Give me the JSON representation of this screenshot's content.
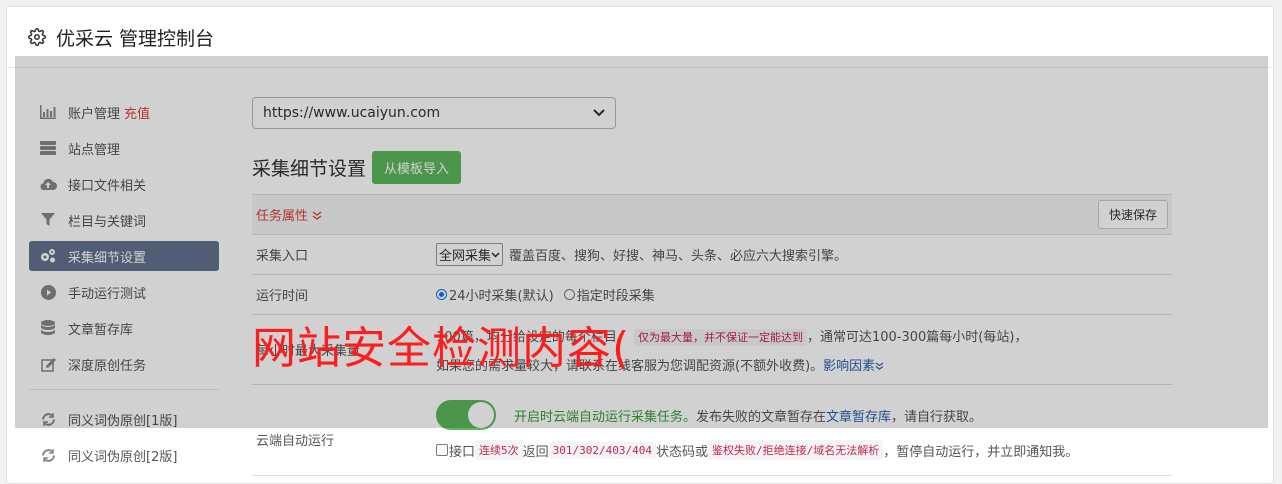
{
  "header": {
    "title": "优采云 管理控制台",
    "icon": "gear-icon"
  },
  "sidebar": {
    "items": [
      {
        "label": "账户管理",
        "badge": "充值",
        "icon": "bar-chart-icon"
      },
      {
        "label": "站点管理",
        "icon": "server-icon"
      },
      {
        "label": "接口文件相关",
        "icon": "cloud-upload-icon"
      },
      {
        "label": "栏目与关键词",
        "icon": "filter-icon"
      },
      {
        "label": "采集细节设置",
        "icon": "gears-icon",
        "active": true
      },
      {
        "label": "手动运行测试",
        "icon": "play-icon"
      },
      {
        "label": "文章暂存库",
        "icon": "database-icon"
      },
      {
        "label": "深度原创任务",
        "icon": "edit-icon"
      },
      {
        "label": "同义词伪原创[1版]",
        "icon": "refresh-icon"
      },
      {
        "label": "同义词伪原创[2版]",
        "icon": "refresh-icon"
      }
    ]
  },
  "main": {
    "site_select": "https://www.ucaiyun.com",
    "section_title": "采集细节设置",
    "import_button": "从模板导入",
    "task_property": "任务属性",
    "quick_save": "快速保存",
    "entry": {
      "label": "采集入口",
      "select": "全网采集",
      "desc": "覆盖百度、搜狗、好搜、神马、头条、必应六大搜索引擎。"
    },
    "runtime": {
      "label": "运行时间",
      "opt1": "24小时采集(默认)",
      "opt2": "指定时段采集"
    },
    "max_label": "每小时最大采集量",
    "max": {
      "prefix": "100",
      "mid": "篇，均分给设定的每个栏目。",
      "code": "仅为最大量，并不保证一定能达到",
      "suffix": "，通常可达100-300篇每小时(每站)，",
      "line2": "如果您的需求量较大，请联系在线客服为您调配资源(不额外收费)。",
      "link": "影响因素"
    },
    "cloud": {
      "label": "云端自动运行",
      "desc_green": "开启时云端自动运行采集任务。",
      "desc": "发布失败的文章暂存在",
      "desc_link": "文章暂存库",
      "desc_end": "，请自行获取。",
      "check_label": "接口",
      "code1": "连续5次",
      "t1": "返回",
      "code2": "301/302/403/404",
      "t2": "状态码或",
      "code3": "鉴权失败/拒绝连接/域名无法解析",
      "t3": "，暂停自动运行，并立即通知我。"
    }
  },
  "watermark": "网站安全检测内容("
}
